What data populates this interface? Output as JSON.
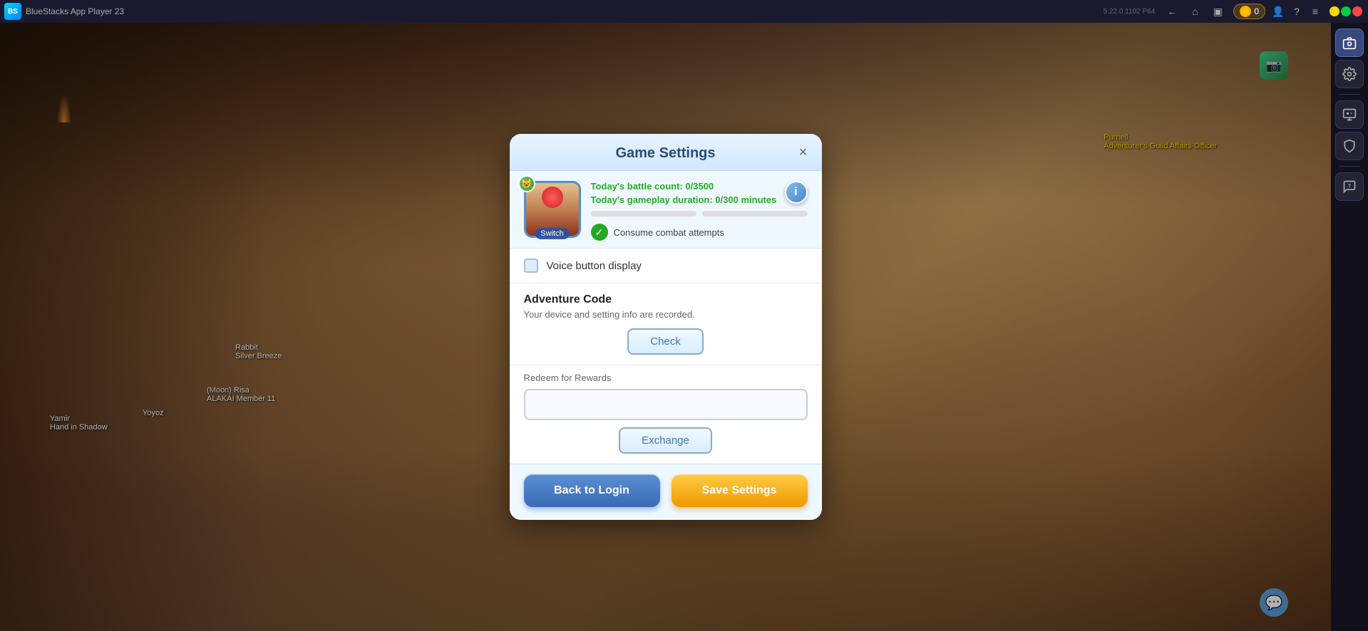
{
  "titlebar": {
    "app_name": "BlueStacks App Player 23",
    "version": "5.22.0.1102  P64",
    "coin_count": "0",
    "logo_text": "BS"
  },
  "modal": {
    "title": "Game Settings",
    "close_label": "×",
    "battle_count_label": "Today's battle count:",
    "battle_count_value": "0/3500",
    "duration_label": "Today's gameplay duration:",
    "duration_value": "0/300",
    "duration_unit": "minutes",
    "consume_label": "Consume combat attempts",
    "voice_label": "Voice button display",
    "adventure_code_title": "Adventure Code",
    "adventure_code_desc": "Your device and setting info are recorded.",
    "check_btn": "Check",
    "redeem_label": "Redeem for Rewards",
    "redeem_placeholder": "",
    "exchange_btn": "Exchange",
    "back_to_login": "Back to Login",
    "save_settings": "Save Settings"
  },
  "avatar": {
    "switch_label": "Switch"
  },
  "sidebar": {
    "icons": [
      "📷",
      "🎮",
      "⚙",
      "🛡",
      "💬"
    ]
  }
}
